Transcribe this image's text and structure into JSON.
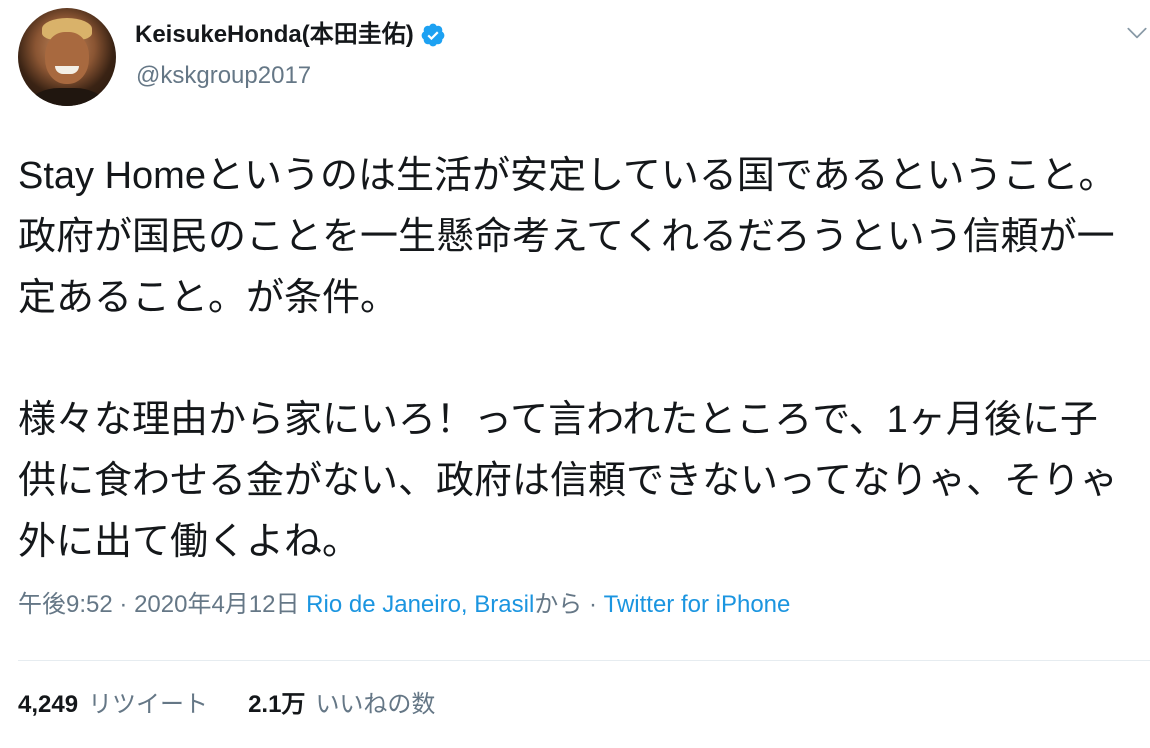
{
  "user": {
    "display_name": "KeisukeHonda(本田圭佑)",
    "handle": "@kskgroup2017",
    "verified": true
  },
  "icons": {
    "verified": "verified-badge-icon",
    "menu": "chevron-down-icon",
    "avatar": "user-avatar-photo"
  },
  "colors": {
    "text": "#14171a",
    "secondary": "#657786",
    "link": "#1b95e0",
    "verified": "#1da1f2",
    "divider": "#e6ecf0"
  },
  "tweet": {
    "text": "Stay Homeというのは生活が安定している国であるということ。政府が国民のことを一生懸命考えてくれるだろうという信頼が一定あること。が条件。\n\n様々な理由から家にいろ！って言われたところで、1ヶ月後に子供に食わせる金がない、政府は信頼できないってなりゃ、そりゃ外に出て働くよね。",
    "time": "午後9:52",
    "date": "2020年4月12日",
    "location": "Rio de Janeiro, Brasil",
    "location_suffix": "から",
    "separator": "·",
    "source": "Twitter for iPhone"
  },
  "stats": {
    "retweets_count": "4,249",
    "retweets_label": "リツイート",
    "likes_count": "2.1万",
    "likes_label": "いいねの数"
  }
}
